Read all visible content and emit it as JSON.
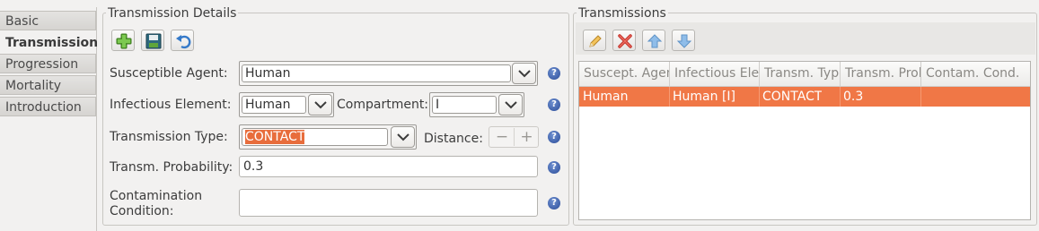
{
  "tabs": [
    {
      "label": "Basic",
      "active": false
    },
    {
      "label": "Transmission",
      "active": true
    },
    {
      "label": "Progression",
      "active": false
    },
    {
      "label": "Mortality",
      "active": false
    },
    {
      "label": "Introduction",
      "active": false
    }
  ],
  "details": {
    "title": "Transmission Details",
    "toolbar": {
      "add": "add-icon",
      "save": "save-icon",
      "undo": "undo-icon"
    },
    "susceptible_agent": {
      "label": "Susceptible Agent:",
      "value": "Human"
    },
    "infectious_element": {
      "label": "Infectious Element:",
      "value": "Human"
    },
    "compartment": {
      "label": "Compartment:",
      "value": "I"
    },
    "transmission_type": {
      "label": "Transmission Type:",
      "value": "CONTACT"
    },
    "distance": {
      "label": "Distance:",
      "minus": "−",
      "plus": "+"
    },
    "probability": {
      "label": "Transm. Probability:",
      "value": "0.3"
    },
    "contamination": {
      "label_line1": "Contamination",
      "label_line2": "Condition:",
      "value": ""
    },
    "help_glyph": "?"
  },
  "transmissions": {
    "title": "Transmissions",
    "toolbar": {
      "edit": "pencil-icon",
      "delete": "delete-icon",
      "up": "arrow-up-icon",
      "down": "arrow-down-icon"
    },
    "columns": [
      "Suscept. Agent",
      "Infectious Element",
      "Transm. Type",
      "Transm. Probability",
      "Contam. Cond."
    ],
    "rows": [
      {
        "agent": "Human",
        "element": "Human [I]",
        "type": "CONTACT",
        "probability": "0.3",
        "condition": ""
      }
    ]
  },
  "colors": {
    "selection": "#f07746",
    "accent": "#e86d3c"
  }
}
